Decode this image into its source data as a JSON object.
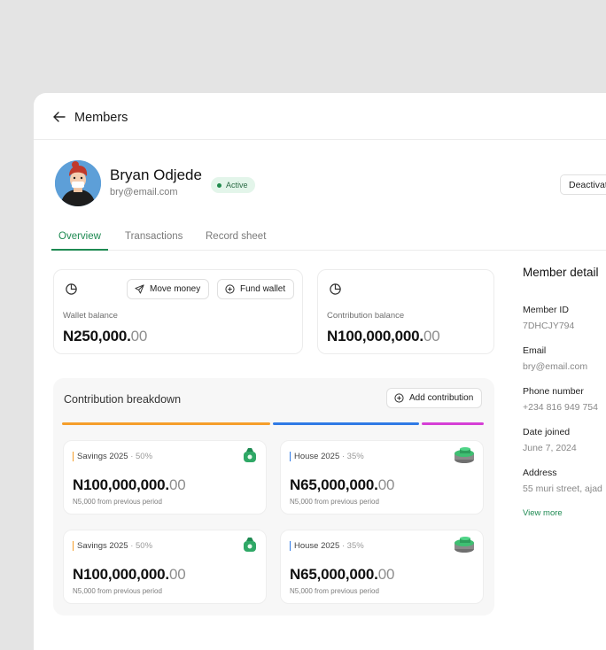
{
  "header": {
    "title": "Members"
  },
  "member": {
    "name": "Bryan Odjede",
    "email": "bry@email.com",
    "status": "Active",
    "deactivate_label": "Deactivat"
  },
  "tabs": [
    {
      "label": "Overview",
      "active": true
    },
    {
      "label": "Transactions",
      "active": false
    },
    {
      "label": "Record sheet",
      "active": false
    }
  ],
  "wallet": {
    "label": "Wallet balance",
    "amount_main": "N250,000.",
    "amount_dec": "00",
    "move_money_label": "Move money",
    "fund_wallet_label": "Fund wallet"
  },
  "contribution": {
    "label": "Contribution balance",
    "amount_main": "N100,000,000.",
    "amount_dec": "00"
  },
  "breakdown": {
    "title": "Contribution breakdown",
    "add_label": "Add contribution",
    "bars": [
      {
        "color": "#f59e2a",
        "fraction": 0.5
      },
      {
        "color": "#2f7ae5",
        "fraction": 0.35
      },
      {
        "color": "#d63fd6",
        "fraction": 0.15
      }
    ],
    "cards": [
      {
        "name": "Savings 2025",
        "pct": "· 50%",
        "amount_main": "N100,000,000.",
        "amount_dec": "00",
        "sub": "N5,000 from previous period",
        "accent": "#f59e2a",
        "icon": "money-bag-icon"
      },
      {
        "name": "House 2025",
        "pct": "· 35%",
        "amount_main": "N65,000,000.",
        "amount_dec": "00",
        "sub": "N5,000 from previous period",
        "accent": "#2f7ae5",
        "icon": "coin-stack-icon"
      },
      {
        "name": "Savings 2025",
        "pct": "· 50%",
        "amount_main": "N100,000,000.",
        "amount_dec": "00",
        "sub": "N5,000 from previous period",
        "accent": "#f59e2a",
        "icon": "money-bag-icon"
      },
      {
        "name": "House 2025",
        "pct": "· 35%",
        "amount_main": "N65,000,000.",
        "amount_dec": "00",
        "sub": "N5,000 from previous period",
        "accent": "#2f7ae5",
        "icon": "coin-stack-icon"
      }
    ]
  },
  "details": {
    "title": "Member detail",
    "fields": [
      {
        "label": "Member ID",
        "value": "7DHCJY794"
      },
      {
        "label": "Email",
        "value": "bry@email.com"
      },
      {
        "label": "Phone number",
        "value": "+234 816 949 754"
      },
      {
        "label": "Date joined",
        "value": "June 7, 2024"
      },
      {
        "label": "Address",
        "value": "55 muri street, ajad"
      }
    ],
    "view_more": "View more"
  },
  "colors": {
    "accent_green": "#1e8a52",
    "badge_bg": "#e3f5ea"
  }
}
